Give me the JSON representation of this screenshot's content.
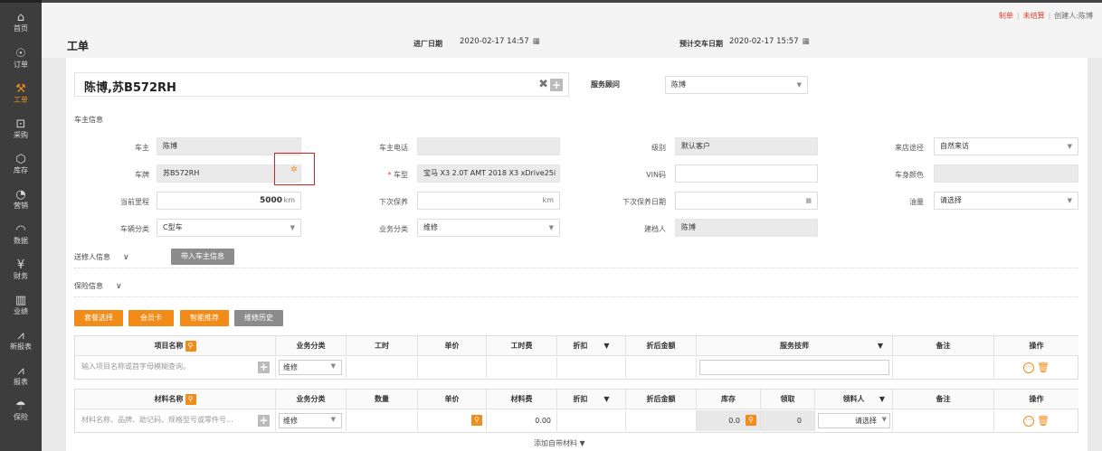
{
  "sidebar": {
    "items": [
      {
        "label": "首页",
        "icon": "home-icon",
        "glyph": "⌂"
      },
      {
        "label": "订单",
        "icon": "order-icon",
        "glyph": "☉"
      },
      {
        "label": "工单",
        "icon": "wrench-icon",
        "glyph": "⚒",
        "active": true
      },
      {
        "label": "采购",
        "icon": "cart-icon",
        "glyph": "⊡"
      },
      {
        "label": "库存",
        "icon": "cube-icon",
        "glyph": "⬡"
      },
      {
        "label": "营销",
        "icon": "marketing-icon",
        "glyph": "◔"
      },
      {
        "label": "数据",
        "icon": "data-icon",
        "glyph": "◠"
      },
      {
        "label": "财务",
        "icon": "yen-icon",
        "glyph": "¥"
      },
      {
        "label": "业绩",
        "icon": "bar-chart-icon",
        "glyph": "▥"
      },
      {
        "label": "新报表",
        "icon": "line-chart-icon",
        "glyph": "⩘"
      },
      {
        "label": "报表",
        "icon": "report-icon",
        "glyph": "⩘"
      },
      {
        "label": "保险",
        "icon": "umbrella-icon",
        "glyph": "☂"
      }
    ]
  },
  "topbar": {
    "status1": "制单",
    "status2": "未结算",
    "creator": "创建人:陈博"
  },
  "header": {
    "title": "工单",
    "entry_label": "进厂日期",
    "entry_value": "2020-02-17 14:57",
    "delivery_label": "预计交车日期",
    "delivery_value": "2020-02-17 15:57"
  },
  "customer": {
    "name": "陈博,苏B572RH",
    "advisor_label": "服务顾问",
    "advisor_value": "陈博"
  },
  "owner_section": "车主信息",
  "fields": {
    "owner_label": "车主",
    "owner_value": "陈博",
    "phone_label": "车主电话",
    "phone_value": "",
    "level_label": "级别",
    "level_value": "默认客户",
    "source_label": "来店途径",
    "source_value": "自然来访",
    "plate_label": "车牌",
    "plate_value": "苏B572RH",
    "model_label": "车型",
    "model_value": "宝马 X3 2.0T AMT 2018 X3 xDrive25i",
    "vin_label": "VIN码",
    "vin_value": "",
    "color_label": "车身颜色",
    "color_value": "",
    "mileage_label": "当前里程",
    "mileage_value": "5000",
    "mileage_unit": "km",
    "next_maint_label": "下次保养",
    "next_maint_unit": "km",
    "next_maint_date_label": "下次保养日期",
    "oil_label": "油量",
    "oil_value": "请选择",
    "category_label": "车辆分类",
    "category_value": "C型车",
    "biz_label": "业务分类",
    "biz_value": "维修",
    "creator_label": "建档人",
    "creator_value": "陈博"
  },
  "sections": {
    "sender": "送修人信息",
    "bring_owner": "带入车主信息",
    "insurance": "保险信息"
  },
  "actions": {
    "package": "套餐选择",
    "member": "会员卡",
    "smart": "智能推荐",
    "history": "维修历史"
  },
  "items_table": {
    "headers": [
      "项目名称",
      "业务分类",
      "工时",
      "单价",
      "工时费",
      "折扣",
      "折后金额",
      "服务技师",
      "备注",
      "操作"
    ],
    "placeholder": "输入项目名称或首字母模糊查询。",
    "biz": "维修"
  },
  "materials_table": {
    "headers": [
      "材料名称",
      "业务分类",
      "数量",
      "单价",
      "材料费",
      "折扣",
      "折后金额",
      "库存",
      "领取",
      "领料人",
      "备注",
      "操作"
    ],
    "placeholder": "材料名称、品牌、助记码、规格型号或零件号...",
    "biz": "维修",
    "fee": "0.00",
    "stock": "0.0",
    "received": "0",
    "picker": "请选择"
  },
  "footer_link": "添加自带材料 ▼"
}
